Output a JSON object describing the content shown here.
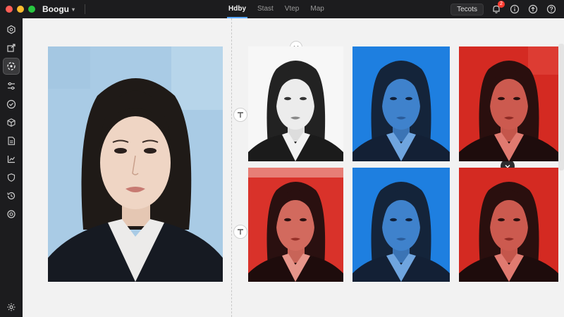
{
  "titlebar": {
    "app_name": "Boogu",
    "tabs": [
      {
        "label": "Hdby",
        "active": true
      },
      {
        "label": "Stast",
        "active": false
      },
      {
        "label": "Vtep",
        "active": false
      },
      {
        "label": "Map",
        "active": false
      }
    ],
    "button_label": "Tecots",
    "notification_count": "2"
  },
  "rail": {
    "icons": [
      "hexagon-icon",
      "export-icon",
      "face-detect-icon",
      "adjust-icon",
      "check-circle-icon",
      "box-icon",
      "document-icon",
      "chart-icon",
      "shield-icon",
      "history-icon",
      "target-icon",
      "settings-icon"
    ]
  },
  "canvas": {
    "variants": [
      {
        "background": "#f7f7f7",
        "tint": "grayscale"
      },
      {
        "background": "#1e7fe0",
        "tint": "blue"
      },
      {
        "background": "#d42a22",
        "tint": "red"
      },
      {
        "background": "#d9322a",
        "tint": "red"
      },
      {
        "background": "#1e7fe0",
        "tint": "blue"
      },
      {
        "background": "#d42a22",
        "tint": "red"
      }
    ]
  },
  "colors": {
    "source_bg": "#a9cbe5",
    "accent": "#5aa9ff"
  }
}
